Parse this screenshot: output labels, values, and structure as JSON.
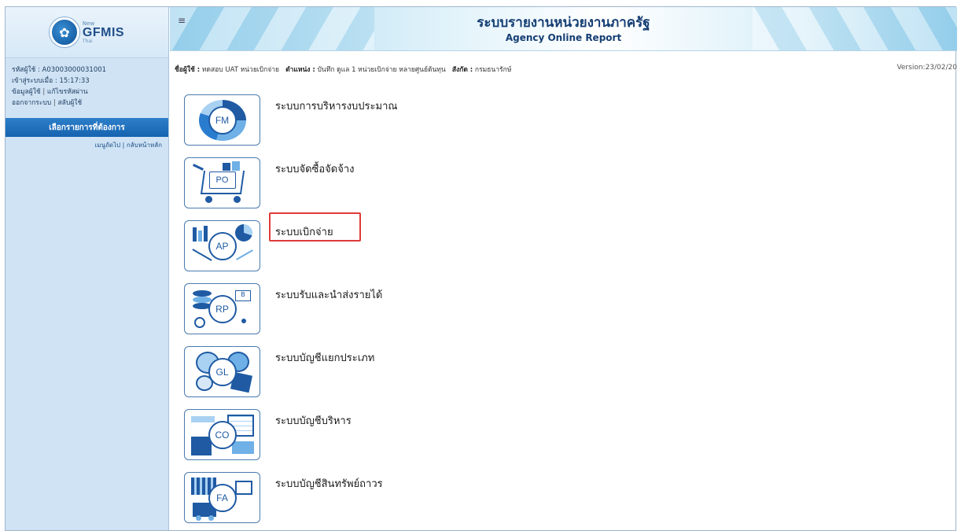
{
  "logo": {
    "new": "New",
    "name": "GFMIS",
    "sub": "Thai"
  },
  "user": {
    "user_id": "รหัสผู้ใช้ : A03003000031001",
    "login_time": "เข้าสู่ระบบเมื่อ : 15:17:33",
    "profile_link": "ข้อมูลผู้ใช้",
    "change_password_link": "แก้ไขรหัสผ่าน",
    "logout_link": "ออกจากระบบ",
    "switch_user_link": "สลับผู้ใช้"
  },
  "menu": {
    "header": "เลือกรายการที่ต้องการ",
    "next_menu": "เมนูถัดไป",
    "back_home": "กลับหน้าหลัก"
  },
  "header": {
    "title_th": "ระบบรายงานหน่วยงานภาครัฐ",
    "title_en": "Agency Online Report"
  },
  "info": {
    "user_label": "ชื่อผู้ใช้ :",
    "user_value": "ทดสอบ UAT หน่วยเบิกจ่าย",
    "position_label": "ตำแหน่ง :",
    "position_value": "บันทึก ดูแล 1 หน่วยเบิกจ่าย หลายศูนย์ต้นทุน",
    "dept_label": "สังกัด :",
    "dept_value": "กรมธนารักษ์",
    "version": "Version:23/02/20"
  },
  "systems": [
    {
      "code": "FM",
      "label": "ระบบการบริหารงบประมาณ",
      "icon": "budget-icon"
    },
    {
      "code": "PO",
      "label": "ระบบจัดซื้อจัดจ้าง",
      "icon": "shopping-cart-icon"
    },
    {
      "code": "AP",
      "label": "ระบบเบิกจ่าย",
      "icon": "chart-icon"
    },
    {
      "code": "RP",
      "label": "ระบบรับและนำส่งรายได้",
      "icon": "coins-icon"
    },
    {
      "code": "GL",
      "label": "ระบบบัญชีแยกประเภท",
      "icon": "ledger-icon"
    },
    {
      "code": "CO",
      "label": "ระบบบัญชีบริหาร",
      "icon": "calculator-icon"
    },
    {
      "code": "FA",
      "label": "ระบบบัญชีสินทรัพย์ถาวร",
      "icon": "building-icon"
    }
  ],
  "colors": {
    "accent": "#1663b0",
    "highlight": "#e03a3a",
    "sidebar": "#cfe3f5"
  }
}
